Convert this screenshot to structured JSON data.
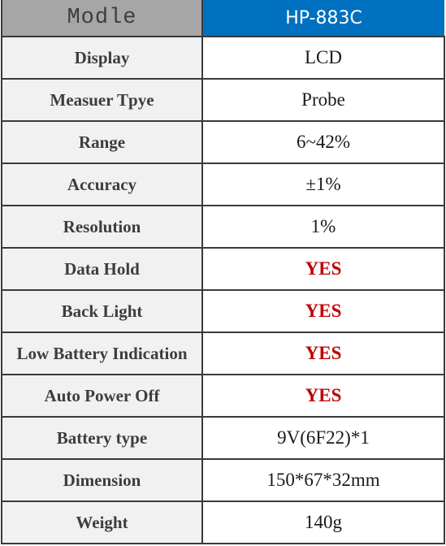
{
  "header": {
    "label": "Modle",
    "value": "HP-883C"
  },
  "colors": {
    "header_value_bg": "#0070c0",
    "header_label_bg": "#a6a6a6",
    "yes_color": "#c00000",
    "label_bg": "#f1f1f1"
  },
  "rows": [
    {
      "label": "Display",
      "value": "LCD",
      "highlight": false
    },
    {
      "label": "Measuer Tpye",
      "value": "Probe",
      "highlight": false
    },
    {
      "label": "Range",
      "value": "6~42%",
      "highlight": false
    },
    {
      "label": "Accuracy",
      "value": "±1%",
      "highlight": false
    },
    {
      "label": "Resolution",
      "value": "1%",
      "highlight": false
    },
    {
      "label": "Data Hold",
      "value": "YES",
      "highlight": true
    },
    {
      "label": "Back Light",
      "value": "YES",
      "highlight": true
    },
    {
      "label": "Low Battery Indication",
      "value": "YES",
      "highlight": true
    },
    {
      "label": "Auto Power Off",
      "value": "YES",
      "highlight": true
    },
    {
      "label": "Battery type",
      "value": "9V(6F22)*1",
      "highlight": false
    },
    {
      "label": "Dimension",
      "value": "150*67*32mm",
      "highlight": false
    },
    {
      "label": "Weight",
      "value": "140g",
      "highlight": false
    }
  ]
}
